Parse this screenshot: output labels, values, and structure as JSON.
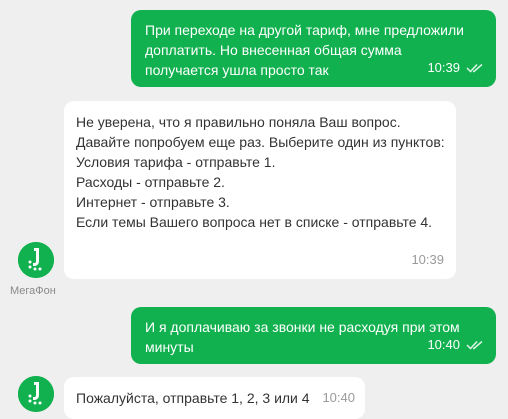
{
  "chat": {
    "messages": [
      {
        "side": "out",
        "text": "При переходе на другой тариф, мне предложили доплатить. Но внесенная общая сумма получается ушла просто так",
        "time": "10:39",
        "status": "read"
      },
      {
        "side": "in",
        "text": "Не уверена, что я правильно поняла Ваш вопрос. Давайте попробуем еще раз. Выберите один из пунктов:\nУсловия тарифа - отправьте 1.\nРасходы - отправьте 2.\nИнтернет - отправьте 3.\nЕсли темы Вашего вопроса нет в списке - отправьте 4.",
        "time": "10:39"
      },
      {
        "side": "out",
        "text": "И я доплачиваю за звонки не расходуя при этом минуты",
        "time": "10:40",
        "status": "read"
      },
      {
        "side": "in",
        "text": "Пожалуйста, отправьте 1, 2, 3 или 4",
        "time": "10:40"
      }
    ],
    "bot": {
      "name": "МегаФон",
      "avatar_icon": "megafon-logo-icon",
      "brand_color": "#10b14e"
    },
    "read_icon": "double-check-icon"
  }
}
